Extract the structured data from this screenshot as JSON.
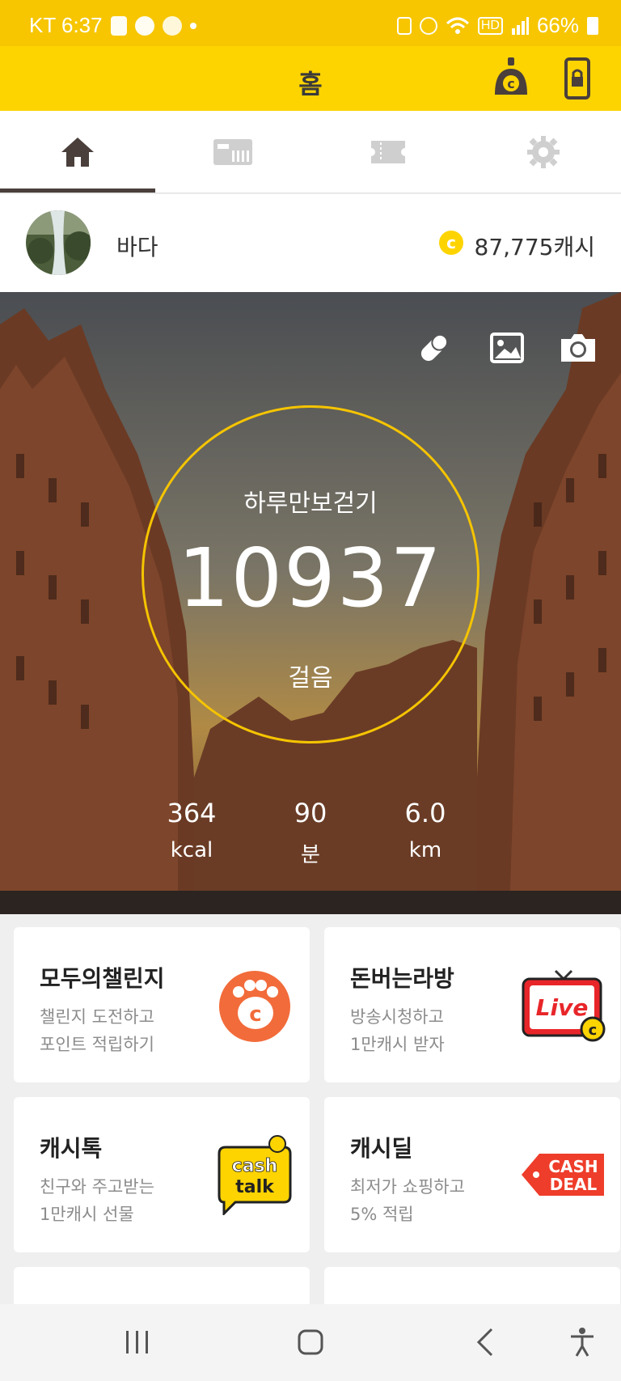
{
  "status_bar": {
    "carrier_time": "KT 6:37",
    "battery": "66%"
  },
  "app_bar": {
    "title": "홈",
    "icons": [
      "cash-avatar-icon",
      "phone-lock-icon"
    ]
  },
  "tabs": [
    {
      "icon": "home-icon",
      "active": true
    },
    {
      "icon": "gift-card-icon",
      "active": false
    },
    {
      "icon": "ticket-icon",
      "active": false
    },
    {
      "icon": "gear-icon",
      "active": false
    }
  ],
  "profile": {
    "name": "바다",
    "cash": "87,775캐시"
  },
  "steps": {
    "title": "하루만보걷기",
    "count": "10937",
    "unit": "걸음",
    "stats": [
      {
        "value": "364",
        "unit": "kcal"
      },
      {
        "value": "90",
        "unit": "분"
      },
      {
        "value": "6.0",
        "unit": "km"
      }
    ]
  },
  "cards": [
    {
      "title": "모두의챌린지",
      "line1": "챌린지 도전하고",
      "line2": "포인트 적립하기",
      "icon": "paw-coin-icon"
    },
    {
      "title": "돈버는라방",
      "line1": "방송시청하고",
      "line2": "1만캐시 받자",
      "icon": "live-tv-icon"
    },
    {
      "title": "캐시톡",
      "line1": "친구와 주고받는",
      "line2": "1만캐시 선물",
      "icon": "cash-talk-icon"
    },
    {
      "title": "캐시딜",
      "line1": "최저가 쇼핑하고",
      "line2": "5% 적립",
      "icon": "cash-deal-icon"
    }
  ],
  "art_text": {
    "live": "Live",
    "cash": "cash",
    "talk": "talk",
    "deal1": "CASH",
    "deal2": "DEAL"
  },
  "colors": {
    "status_bar": "#f7c600",
    "app_bar": "#fdd400",
    "accent": "#f5c400",
    "challenge_orange": "#f26b3a",
    "live_red": "#e8262a"
  }
}
